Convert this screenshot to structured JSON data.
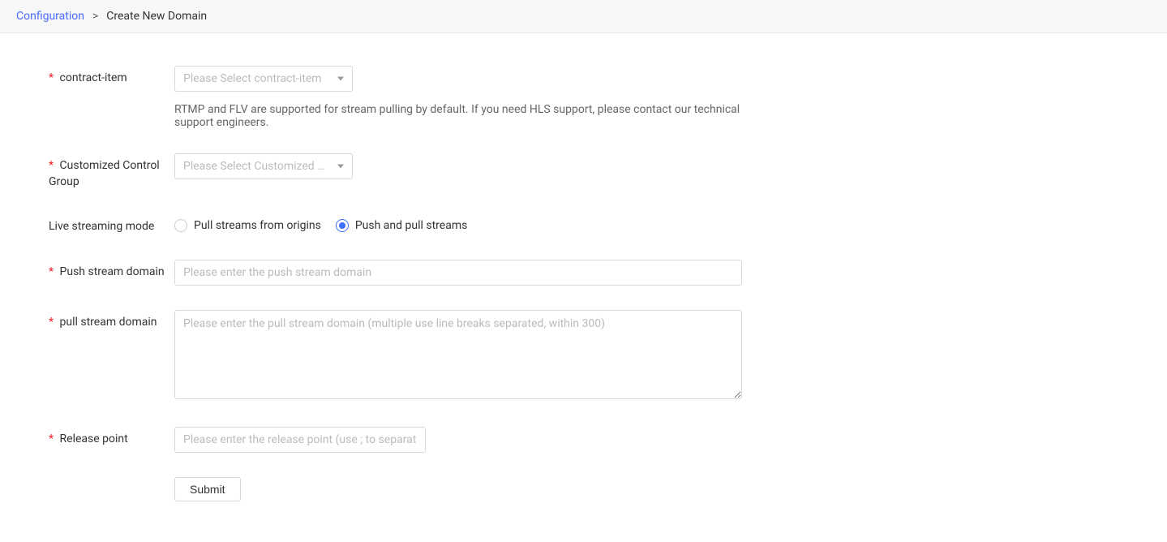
{
  "breadcrumb": {
    "link": "Configuration",
    "separator": ">",
    "current": "Create New Domain"
  },
  "form": {
    "contract_item": {
      "label": "contract-item",
      "placeholder": "Please Select contract-item",
      "helper": "RTMP and FLV are supported for stream pulling by default. If you need HLS support, please contact our technical support engineers."
    },
    "control_group": {
      "label": "Customized Control Group",
      "placeholder": "Please Select Customized Con..."
    },
    "streaming_mode": {
      "label": "Live streaming mode",
      "options": {
        "pull_origins": "Pull streams from origins",
        "push_pull": "Push and pull streams"
      }
    },
    "push_domain": {
      "label": "Push stream domain",
      "placeholder": "Please enter the push stream domain"
    },
    "pull_domain": {
      "label": "pull stream domain",
      "placeholder": "Please enter the pull stream domain (multiple use line breaks separated, within 300)"
    },
    "release_point": {
      "label": "Release point",
      "placeholder": "Please enter the release point (use ; to separate differ"
    },
    "submit_label": "Submit"
  }
}
